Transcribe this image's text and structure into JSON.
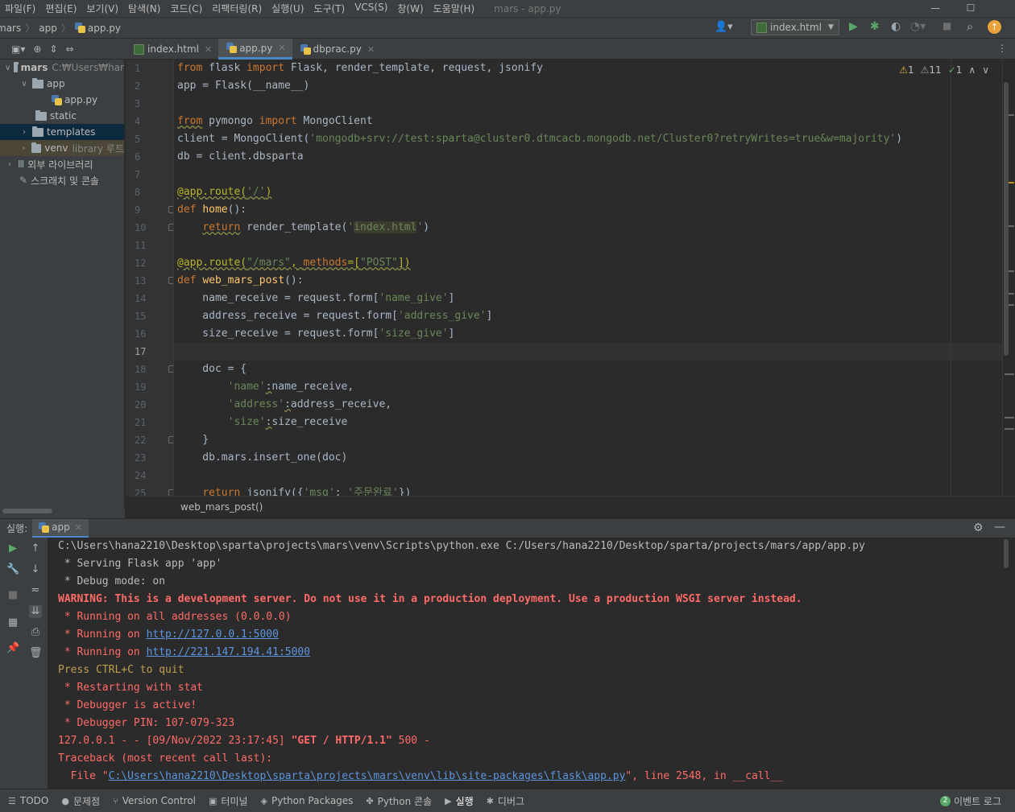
{
  "menu": [
    "파일(F)",
    "편집(E)",
    "보기(V)",
    "탐색(N)",
    "코드(C)",
    "리팩터링(R)",
    "실행(U)",
    "도구(T)",
    "VCS(S)",
    "창(W)",
    "도움말(H)"
  ],
  "window_title": "mars - app.py",
  "breadcrumb": {
    "project": "mars",
    "folder": "app",
    "file": "app.py"
  },
  "run_config": "index.html",
  "tabs": [
    {
      "label": "index.html",
      "icon": "html-file-icon"
    },
    {
      "label": "app.py",
      "icon": "python-file-icon",
      "active": true
    },
    {
      "label": "dbprac.py",
      "icon": "python-file-icon"
    }
  ],
  "tree": {
    "root_label": "mars",
    "root_path": "C:₩Users₩har",
    "app": "app",
    "app_py": "app.py",
    "static": "static",
    "templates": "templates",
    "venv": "venv",
    "venv_hint": "library 루트",
    "external_libs": "외부 라이브러리",
    "scratches": "스크래치 및 콘솔"
  },
  "inspection": {
    "warn1": "1",
    "warn2": "11",
    "ok": "1"
  },
  "code_lines": [
    "<span class=\"kw\">from</span> flask <span class=\"kw\">import</span> Flask, render_template, request, jsonify",
    "app = Flask(__name__)",
    "",
    "<span class=\"kw wavy\">from</span> pymongo <span class=\"kw\">import</span> MongoClient",
    "client = MongoClient(<span class=\"str\">'mongodb+srv://test:sparta@cluster0.dtmcacb.mongodb.net/Cluster0?retryWrites=true&amp;w=majority'</span>)",
    "db = client.dbsparta",
    "",
    "<span class=\"dec wavy\">@app.route(<span class=\"str\">'/'</span>)</span>",
    "<span class=\"kw\">def</span> <span class=\"fn\">home</span>():",
    "    <span class=\"kw wavy\">return</span> render_template(<span class=\"str\">'<span class=\"hl\">index.html</span>'</span>)",
    "",
    "<span class=\"dec wavy\">@app.route(<span class=\"str\">\"/mars\"</span>, <span class=\"kw\">methods</span>=[<span class=\"str\">\"POST\"</span>])</span>",
    "<span class=\"kw\">def</span> <span class=\"fn\">web_mars_post</span>():",
    "    name_receive = request.form[<span class=\"str\">'name_give'</span>]",
    "    address_receive = request.form[<span class=\"str\">'address_give'</span>]",
    "    size_receive = request.form[<span class=\"str\">'size_give'</span>]",
    "",
    "    doc = {",
    "        <span class=\"str\">'name'</span><span class=\"wavy\">:</span>name_receive,",
    "        <span class=\"str\">'address'</span><span class=\"wavy\">:</span>address_receive,",
    "        <span class=\"str\">'size'</span><span class=\"wavy\">:</span>size_receive",
    "    }",
    "    db.mars.insert_one(doc)",
    "",
    "    <span class=\"kw\">return</span> jsonify({<span class=\"str\">'msg'</span>: <span class=\"str\">'주문완료'</span>})"
  ],
  "current_line": 17,
  "fold_lines": [
    9,
    10,
    13,
    18,
    22,
    25
  ],
  "editor_breadcrumb": "web_mars_post()",
  "run": {
    "label": "실행:",
    "tab": "app"
  },
  "console_lines": [
    {
      "cls": "",
      "html": "C:\\Users\\hana2210\\Desktop\\sparta\\projects\\mars\\venv\\Scripts\\python.exe C:/Users/hana2210/Desktop/sparta/projects/mars/app/app.py"
    },
    {
      "cls": "",
      "html": " * Serving Flask app 'app'"
    },
    {
      "cls": "",
      "html": " * Debug mode: on"
    },
    {
      "cls": "redb",
      "html": "WARNING: This is a development server. Do not use it in a production deployment. Use a production WSGI server instead."
    },
    {
      "cls": "red",
      "html": " * Running on all addresses (0.0.0.0)"
    },
    {
      "cls": "red",
      "html": " * Running on <span class=\"link\">http://127.0.0.1:5000</span>"
    },
    {
      "cls": "red",
      "html": " * Running on <span class=\"link\">http://221.147.194.41:5000</span>"
    },
    {
      "cls": "yellow",
      "html": "Press CTRL+C to quit"
    },
    {
      "cls": "red",
      "html": " * Restarting with stat"
    },
    {
      "cls": "red",
      "html": " * Debugger is active!"
    },
    {
      "cls": "red",
      "html": " * Debugger PIN: 107-079-323"
    },
    {
      "cls": "red",
      "html": "127.0.0.1 - - [09/Nov/2022 23:17:45] <b>\"GET / HTTP/1.1\"</b> 500 -"
    },
    {
      "cls": "red",
      "html": "Traceback (most recent call last):"
    },
    {
      "cls": "red",
      "html": "  File \"<span class=\"link\">C:\\Users\\hana2210\\Desktop\\sparta\\projects\\mars\\venv\\lib\\site-packages\\flask\\app.py</span>\", line 2548, in __call__"
    }
  ],
  "statusbar": [
    {
      "label": "TODO",
      "icon": "list-icon"
    },
    {
      "label": "문제점",
      "icon": "problems-icon"
    },
    {
      "label": "Version Control",
      "icon": "vcs-icon"
    },
    {
      "label": "터미널",
      "icon": "terminal-icon"
    },
    {
      "label": "Python Packages",
      "icon": "packages-icon"
    },
    {
      "label": "Python 콘솔",
      "icon": "python-console-icon"
    },
    {
      "label": "실행",
      "icon": "run-icon",
      "active": true
    },
    {
      "label": "디버그",
      "icon": "debug-icon"
    }
  ],
  "event_log": {
    "count": "2",
    "label": "이벤트 로그"
  }
}
